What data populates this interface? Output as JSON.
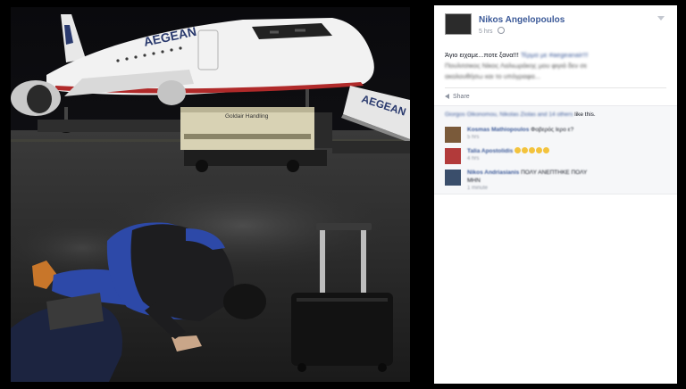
{
  "photo": {
    "airline_text": "AEGEAN",
    "stairs_text": "AEGEAN",
    "truck_text": "Goldair Handling"
  },
  "post": {
    "author": "Nikos Angelopoulos",
    "time": "5 hrs",
    "text_line1": "Άγιο ειχαμε...ποτε ξανα!!!",
    "text_line1_blur": "Τέρμα με #aegeanair!!!",
    "text_line2_blur": "Πουλιτσικος Νίκος Λαλιωράκης μου φιγιά δεν σε",
    "text_line3_blur": "ακολουθήσω και το υπόγραφα...",
    "share_label": "Share"
  },
  "likes": {
    "names": "Giorgos Oikonomou, Nikolas Ziolas and 14 others",
    "suffix": "like this."
  },
  "comments": [
    {
      "name": "Kosmas Mathiopoulos",
      "text": "Φοβερός Ιερο ε?",
      "time": "5 hrs",
      "avatar_color": "#7a5a3a"
    },
    {
      "name": "Talia Apostolidis",
      "text": "",
      "time": "4 hrs",
      "avatar_color": "#b23a3a",
      "emojis": 5
    },
    {
      "name": "Nikos Andriasianis",
      "text": "ΠΟΛΥ ΑΝΕΠΤΗΚΕ ΠΟΛΥ",
      "text2": "ΜΗΝ",
      "time": "1 minute",
      "avatar_color": "#3a4e6b"
    }
  ]
}
